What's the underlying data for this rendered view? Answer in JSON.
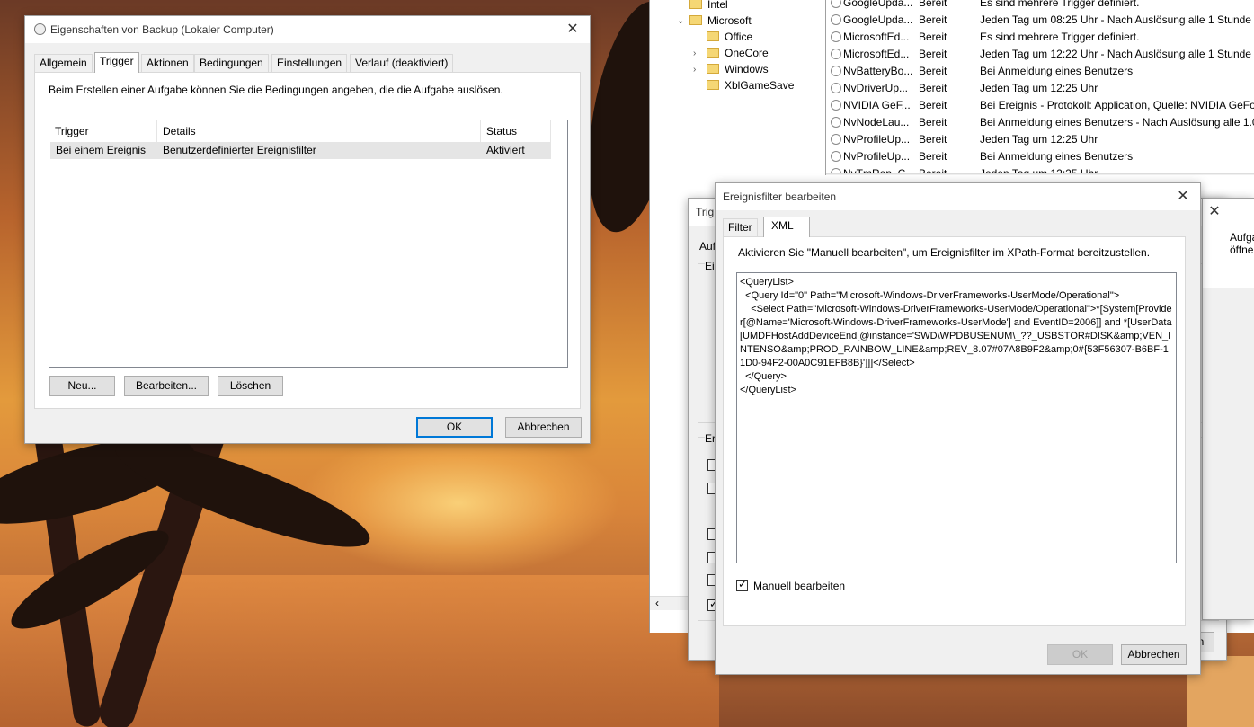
{
  "props_window": {
    "title": "Eigenschaften von Backup (Lokaler Computer)",
    "tabs": [
      "Allgemein",
      "Trigger",
      "Aktionen",
      "Bedingungen",
      "Einstellungen",
      "Verlauf (deaktiviert)"
    ],
    "active_tab": "Trigger",
    "description": "Beim Erstellen einer Aufgabe können Sie die Bedingungen angeben, die die Aufgabe auslösen.",
    "columns": [
      "Trigger",
      "Details",
      "Status"
    ],
    "rows": [
      {
        "trigger": "Bei einem Ereignis",
        "details": "Benutzerdefinierter Ereignisfilter",
        "status": "Aktiviert"
      }
    ],
    "buttons": {
      "new": "Neu...",
      "edit": "Bearbeiten...",
      "delete": "Löschen",
      "ok": "OK",
      "cancel": "Abbrechen"
    }
  },
  "tree": {
    "items": [
      "Intel",
      "Microsoft",
      "Office",
      "OneCore",
      "Windows",
      "XblGameSave"
    ]
  },
  "tasks": [
    {
      "name": "GoogleUpda...",
      "status": "Bereit",
      "trigger": "Es sind mehrere Trigger definiert."
    },
    {
      "name": "GoogleUpda...",
      "status": "Bereit",
      "trigger": "Jeden Tag um 08:25 Uhr - Nach Auslösung alle 1 Stunde fü"
    },
    {
      "name": "MicrosoftEd...",
      "status": "Bereit",
      "trigger": "Es sind mehrere Trigger definiert."
    },
    {
      "name": "MicrosoftEd...",
      "status": "Bereit",
      "trigger": "Jeden Tag um 12:22 Uhr - Nach Auslösung alle 1 Stunde fü"
    },
    {
      "name": "NvBatteryBo...",
      "status": "Bereit",
      "trigger": "Bei Anmeldung eines Benutzers"
    },
    {
      "name": "NvDriverUp...",
      "status": "Bereit",
      "trigger": "Jeden Tag um 12:25 Uhr"
    },
    {
      "name": "NVIDIA GeF...",
      "status": "Bereit",
      "trigger": "Bei Ereignis - Protokoll: Application, Quelle: NVIDIA GeFor"
    },
    {
      "name": "NvNodeLau...",
      "status": "Bereit",
      "trigger": "Bei Anmeldung eines Benutzers - Nach Auslösung alle 1.00"
    },
    {
      "name": "NvProfileUp...",
      "status": "Bereit",
      "trigger": "Jeden Tag um 12:25 Uhr"
    },
    {
      "name": "NvProfileUp...",
      "status": "Bereit",
      "trigger": "Bei Anmeldung eines Benutzers"
    },
    {
      "name": "NvTmRep_C...",
      "status": "Bereit",
      "trigger": "Jeden Tag um 12:25 Uhr"
    }
  ],
  "trigger_window": {
    "title_fragment": "Trig",
    "label_fragment": "Auf",
    "group1_fragment": "Ei",
    "group2_fragment": "Er",
    "right_fragment1": "Aufga",
    "right_fragment2": "öffne",
    "button_fragment": "n"
  },
  "filter_window": {
    "title": "Ereignisfilter bearbeiten",
    "tabs": [
      "Filter",
      "XML"
    ],
    "active_tab": "XML",
    "description": "Aktivieren Sie \"Manuell bearbeiten\", um Ereignisfilter im XPath-Format bereitzustellen.",
    "xml": "<QueryList>\n  <Query Id=\"0\" Path=\"Microsoft-Windows-DriverFrameworks-UserMode/Operational\">\n    <Select Path=\"Microsoft-Windows-DriverFrameworks-UserMode/Operational\">*[System[Provider[@Name='Microsoft-Windows-DriverFrameworks-UserMode'] and EventID=2006]] and *[UserData[UMDFHostAddDeviceEnd[@instance='SWD\\WPDBUSENUM\\_??_USBSTOR#DISK&amp;VEN_INTENSO&amp;PROD_RAINBOW_LINE&amp;REV_8.07#07A8B9F2&amp;0#{53F56307-B6BF-11D0-94F2-00A0C91EFB8B}']]]</Select>\n  </Query>\n</QueryList>",
    "manual_edit_label": "Manuell bearbeiten",
    "manual_edit_checked": true,
    "buttons": {
      "ok": "OK",
      "cancel": "Abbrechen"
    }
  }
}
